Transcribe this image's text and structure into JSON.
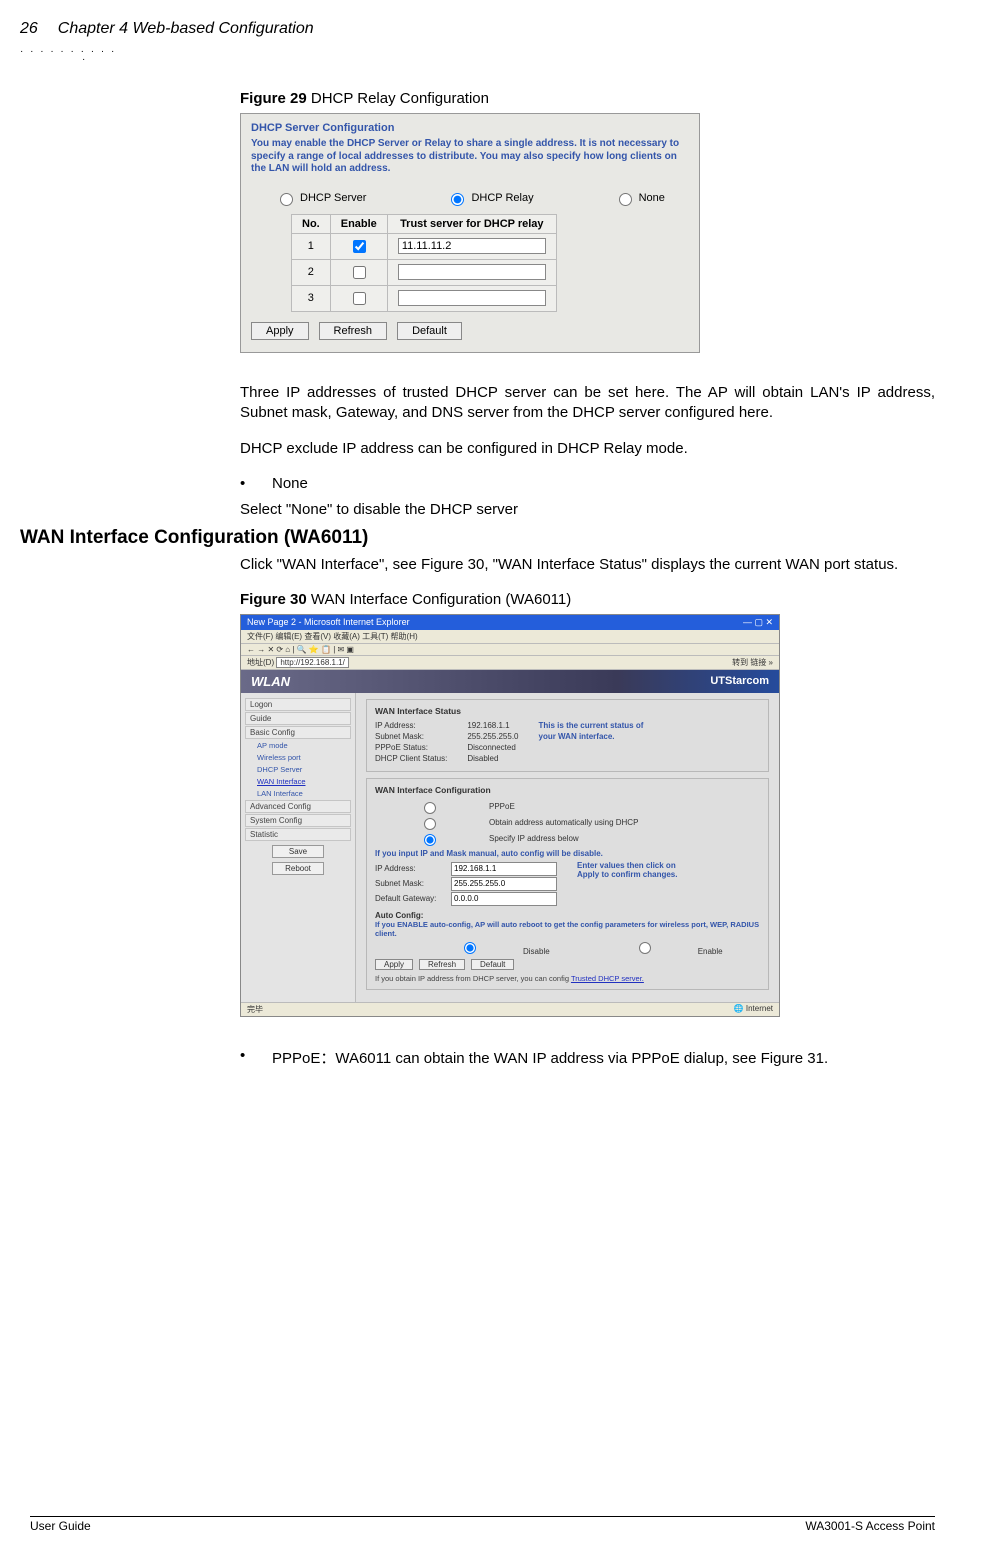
{
  "header": {
    "pageNumber": "26",
    "chapter": "Chapter 4 Web-based Configuration"
  },
  "figure29": {
    "captionBold": "Figure 29",
    "captionRest": " DHCP Relay Configuration",
    "groupTitle": "DHCP Server Configuration",
    "hint": "You may enable the DHCP Server or Relay to share a single address. It is not necessary to specify a range of local addresses to distribute. You may also specify how long clients on the LAN will hold an address.",
    "radios": {
      "server": "DHCP Server",
      "relay": "DHCP Relay",
      "none": "None"
    },
    "table": {
      "headers": {
        "no": "No.",
        "enable": "Enable",
        "trust": "Trust server for DHCP relay"
      },
      "rows": [
        {
          "no": "1",
          "checked": true,
          "value": "11.11.11.2"
        },
        {
          "no": "2",
          "checked": false,
          "value": ""
        },
        {
          "no": "3",
          "checked": false,
          "value": ""
        }
      ]
    },
    "buttons": {
      "apply": "Apply",
      "refresh": "Refresh",
      "default": "Default"
    }
  },
  "paragraphs": {
    "p1": "Three IP addresses of trusted DHCP server can be set here.  The AP will obtain LAN's IP address, Subnet mask, Gateway, and DNS server from the DHCP server configured here.",
    "p2": "DHCP exclude IP address can be configured in DHCP Relay mode.",
    "bullet_none": "None",
    "p3": "Select \"None\" to disable the DHCP server"
  },
  "heading_wan": "WAN Interface Configuration (WA6011)",
  "wan_para": "Click \"WAN Interface\", see Figure 30, \"WAN Interface Status\" displays the current WAN port status.",
  "figure30": {
    "captionBold": "Figure 30",
    "captionRest": " WAN Interface Configuration (WA6011)",
    "window": {
      "title": "New Page 2 - Microsoft Internet Explorer",
      "menubar": "文件(F)  编辑(E)  查看(V)  收藏(A)  工具(T)  帮助(H)",
      "addressLabel": "地址(D)",
      "addressValue": "http://192.168.1.1/",
      "goLabel": "转到",
      "linksLabel": "链接",
      "wlanBrand": "WLAN",
      "utBrand": "UTStarcom"
    },
    "side": {
      "items": [
        "Logon",
        "Guide",
        "Basic Config"
      ],
      "subitems": [
        "AP mode",
        "Wireless port",
        "DHCP Server",
        "WAN Interface",
        "LAN Interface"
      ],
      "items2": [
        "Advanced Config",
        "System Config",
        "Statistic"
      ],
      "btnSave": "Save",
      "btnReboot": "Reboot"
    },
    "status": {
      "title": "WAN Interface Status",
      "rows": {
        "ipLabel": "IP Address:",
        "ipVal": "192.168.1.1",
        "maskLabel": "Subnet Mask:",
        "maskVal": "255.255.255.0",
        "pppoeLabel": "PPPoE Status:",
        "pppoeVal": "Disconnected",
        "dhcpLabel": "DHCP Client Status:",
        "dhcpVal": "Disabled"
      },
      "info": "This is the current status of your WAN interface."
    },
    "config": {
      "title": "WAN Interface Configuration",
      "optPppoe": "PPPoE",
      "optDhcp": "Obtain address automatically using DHCP",
      "optManual": "Specify IP address below",
      "warn": "If you input IP and Mask manual,  auto config will be disable.",
      "ipLabel": "IP Address:",
      "ipVal": "192.168.1.1",
      "maskLabel": "Subnet Mask:",
      "maskVal": "255.255.255.0",
      "gwLabel": "Default Gateway:",
      "gwVal": "0.0.0.0",
      "applyHint": "Enter values then click on Apply to confirm changes.",
      "autoTitle": "Auto Config:",
      "autoHint": "If you ENABLE auto-config, AP will auto reboot to get the config parameters for wireless port, WEP, RADIUS client.",
      "disable": "Disable",
      "enable": "Enable",
      "btnApply": "Apply",
      "btnRefresh": "Refresh",
      "btnDefault": "Default",
      "footHint": "If you obtain IP address from DHCP server, you can config ",
      "footLink": "Trusted DHCP server."
    },
    "statusbar": {
      "done": "完毕",
      "zone": "Internet"
    }
  },
  "bullet_pppoe": "PPPoE：WA6011 can obtain the WAN IP address via PPPoE dialup, see Figure 31.",
  "footer": {
    "left": "User Guide",
    "right": "WA3001-S Access Point"
  }
}
